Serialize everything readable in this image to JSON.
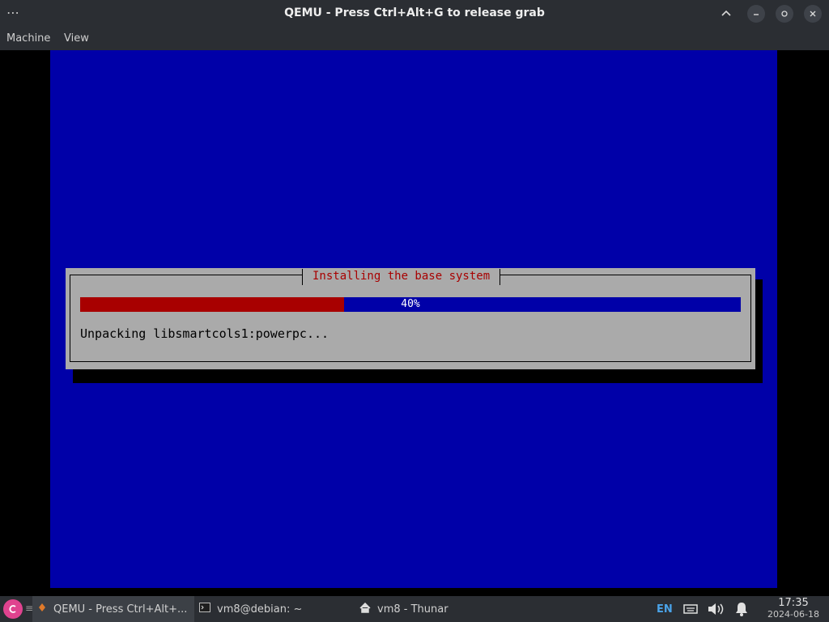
{
  "window": {
    "title": "QEMU - Press Ctrl+Alt+G to release grab",
    "menu_icon": "ellipsis-icon",
    "controls": [
      "chevron-up-icon",
      "minimize-icon",
      "maximize-icon",
      "close-icon"
    ]
  },
  "menubar": {
    "items": [
      "Machine",
      "View"
    ]
  },
  "installer": {
    "dialog_title": "Installing the base system",
    "progress_percent": 40,
    "progress_text": "40%",
    "status_text": "Unpacking libsmartcols1:powerpc...",
    "colors": {
      "screen_background": "#0000a8",
      "dialog_background": "#aaaaaa",
      "progress_fill": "#a80000",
      "title_text": "#a80000"
    }
  },
  "taskbar": {
    "start_icon": "debian-swirl-icon",
    "separator": "≡",
    "tasks": [
      {
        "label": "QEMU - Press Ctrl+Alt+...",
        "icon": "qemu-icon",
        "active": true
      },
      {
        "label": "vm8@debian: ~",
        "icon": "terminal-icon",
        "active": false
      },
      {
        "label": "vm8 - Thunar",
        "icon": "home-icon",
        "active": false
      }
    ],
    "tray": {
      "language": "EN",
      "icons": [
        "keyboard-icon",
        "volume-icon",
        "bell-icon"
      ]
    },
    "clock": {
      "time": "17:35",
      "date": "2024-06-18"
    }
  }
}
